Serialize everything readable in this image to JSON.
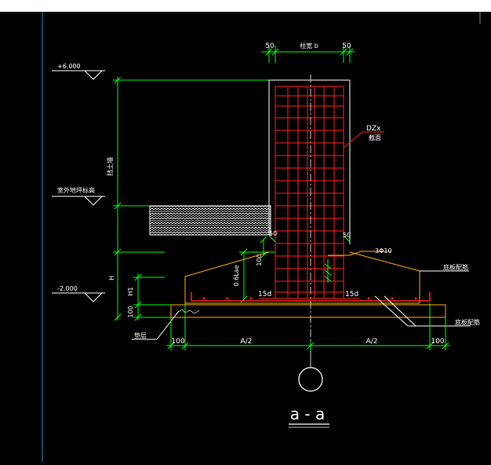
{
  "labels": {
    "dim_left_50": "50",
    "dim_column_width": "柱宽 b",
    "dim_right_50": "50",
    "elev_top": "+6.000",
    "elev_ground": "室外地坪标高",
    "elev_bottom": "-2.000",
    "wall_label": "挡土墙",
    "column_label_1": "DZx",
    "column_label_2": "截面",
    "dim_anchor_left_50": "50",
    "dim_anchor_right_50": "50",
    "anchor_len": "0.6Lae",
    "dim_100_mid": "100",
    "hook_left": "15d",
    "hook_right": "15d",
    "stirrup": "3Φ10",
    "dim_H": "H",
    "dim_H1": "H1",
    "dim_100_base": "100",
    "base_rebar_top": "底板配筋",
    "base_rebar_bottom": "底板配筋",
    "cushion": "垫层",
    "bottom_dim_100_left": "100",
    "bottom_dim_A2_left": "A/2",
    "bottom_dim_A2_right": "A/2",
    "bottom_dim_100_right": "100",
    "section_title": "a - a"
  },
  "colors": {
    "background": "#000000",
    "dimension_green": "#00ff00",
    "outline_white": "#ffffff",
    "rebar_red": "#ff2020",
    "footing_orange": "#ffb000",
    "axis_grey": "#cccccc",
    "left_rule_cyan": "#1e8fb4"
  }
}
